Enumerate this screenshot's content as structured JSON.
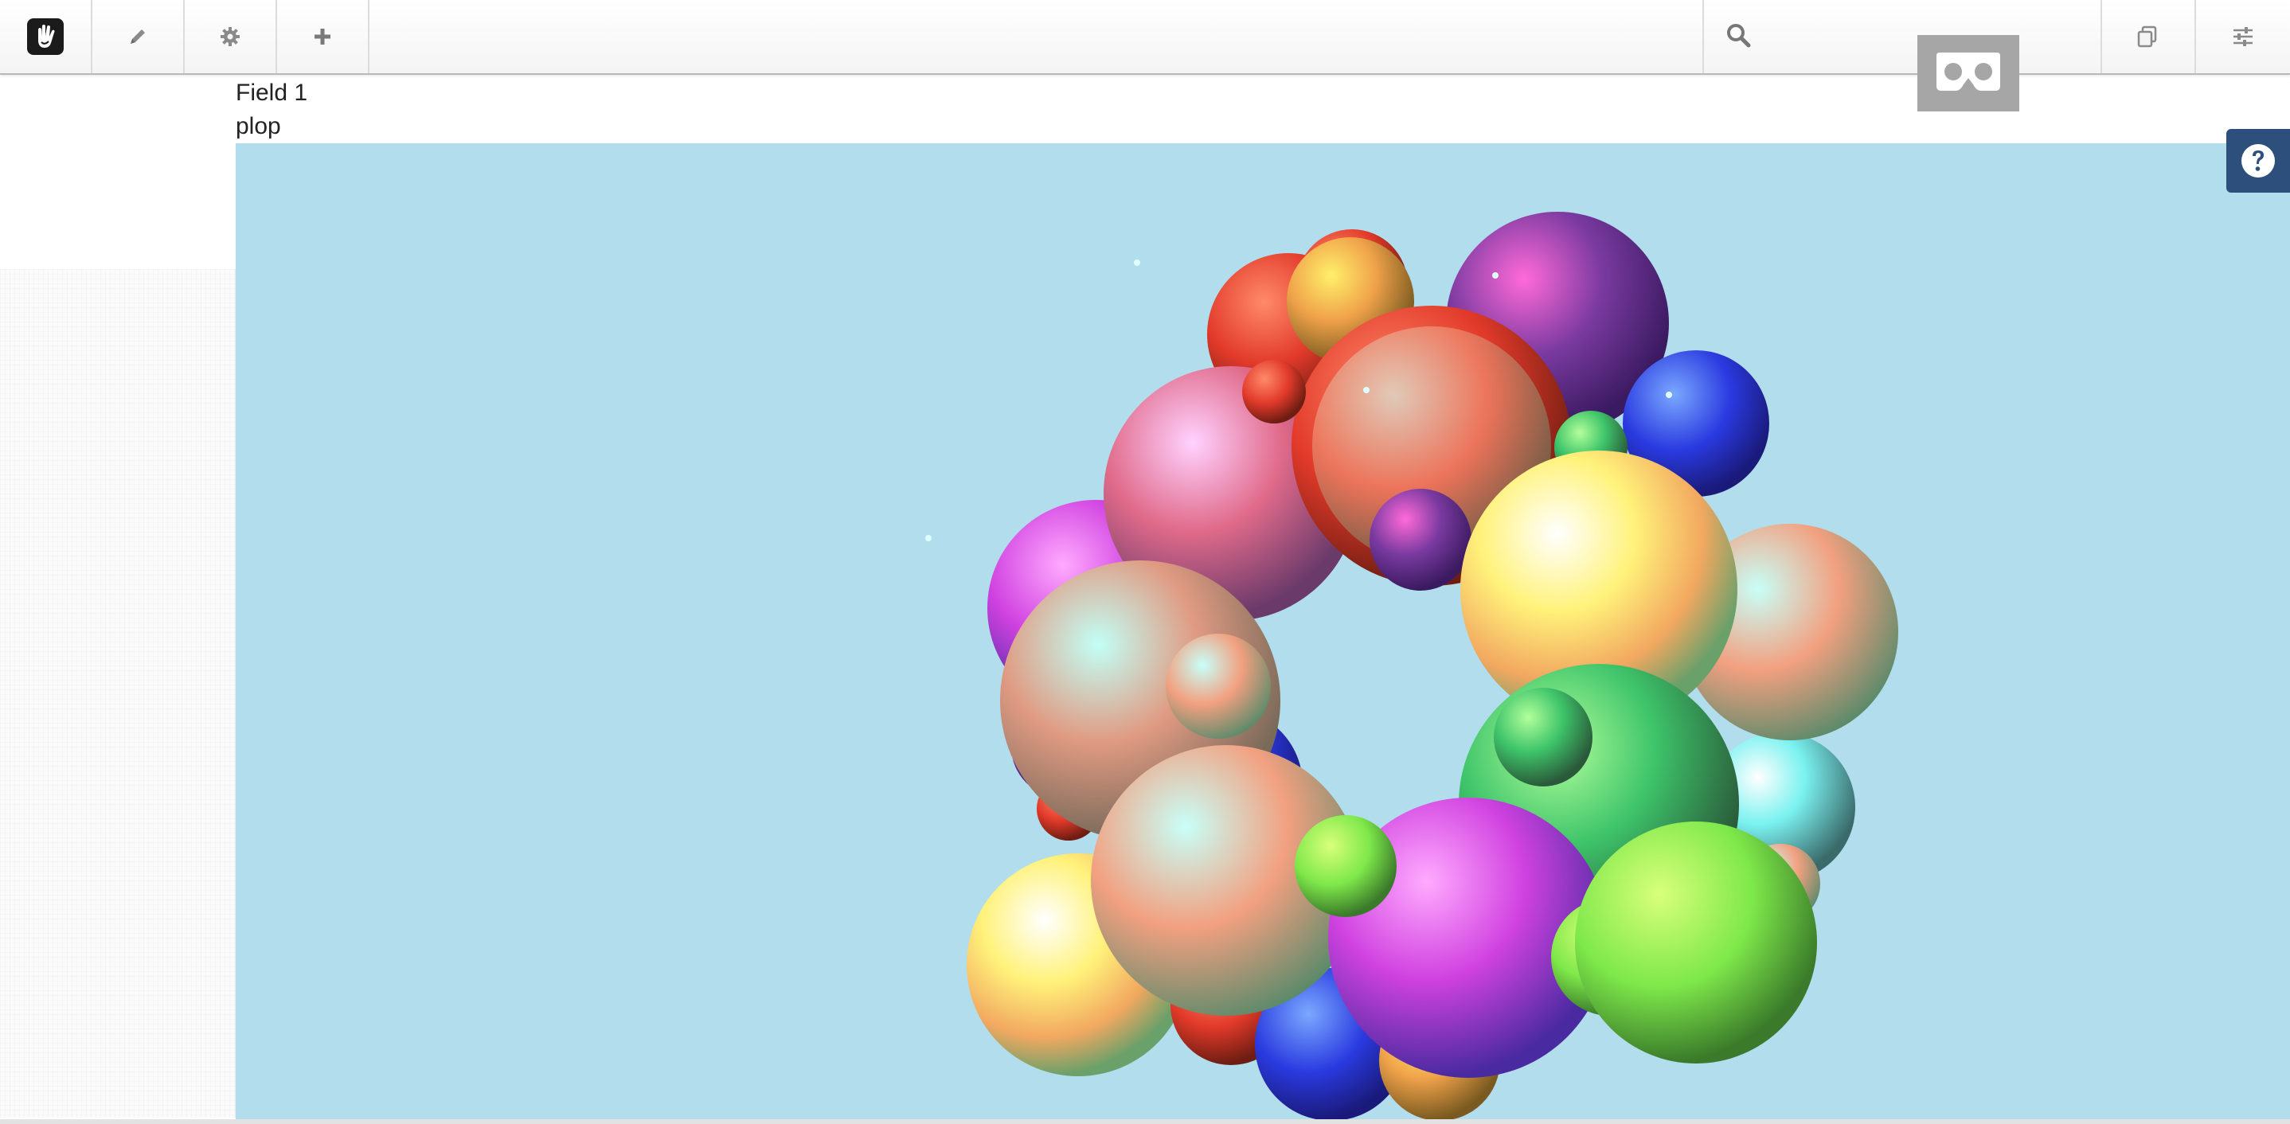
{
  "toolbar": {
    "logo_icon": "hand-logo-icon",
    "edit_icon": "pencil-icon",
    "settings_icon": "gear-icon",
    "add_icon": "plus-icon",
    "search_icon": "search-icon",
    "search_value": "",
    "pages_icon": "pages-icon",
    "panel_icon": "sliders-icon"
  },
  "vr_badge": {
    "icon": "vr-headset-icon"
  },
  "help": {
    "icon": "question-circle-icon"
  },
  "content": {
    "field_label": "Field 1",
    "field_value": "plop"
  },
  "scene": {
    "background_color": "#b1ddec",
    "description_icon": "3d-sphere-cluster"
  }
}
